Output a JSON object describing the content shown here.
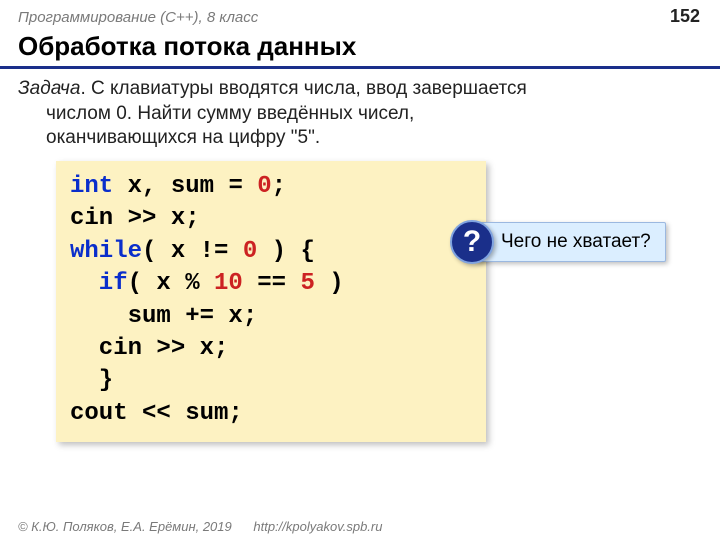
{
  "header": {
    "course": "Программирование (C++), 8 класс",
    "page": "152"
  },
  "title": "Обработка потока данных",
  "task": {
    "label": "Задача",
    "line1": ". С клавиатуры вводятся числа, ввод завершается",
    "line2": "числом 0. Найти сумму введённых чисел,",
    "line3": "оканчивающихся на цифру \"5\"."
  },
  "code": {
    "l1_kw": "int",
    "l1_rest": " x, sum = ",
    "l1_num": "0",
    "l1_end": ";",
    "l2": "cin >> x;",
    "l3_kw": "while",
    "l3_mid": "( x != ",
    "l3_num": "0",
    "l3_end": " ) {",
    "l4_kw": "  if",
    "l4_mid": "( x % ",
    "l4_n1": "10",
    "l4_eq": " == ",
    "l4_n2": "5",
    "l4_end": " )",
    "l5": "    sum += x;",
    "l6": "  cin >> x;",
    "l7": "  }",
    "l8": "cout << sum;"
  },
  "callout": {
    "mark": "?",
    "text": "Чего не хватает?"
  },
  "footer": {
    "copyright": "© К.Ю. Поляков, Е.А. Ерёмин, 2019",
    "url": "http://kpolyakov.spb.ru"
  }
}
